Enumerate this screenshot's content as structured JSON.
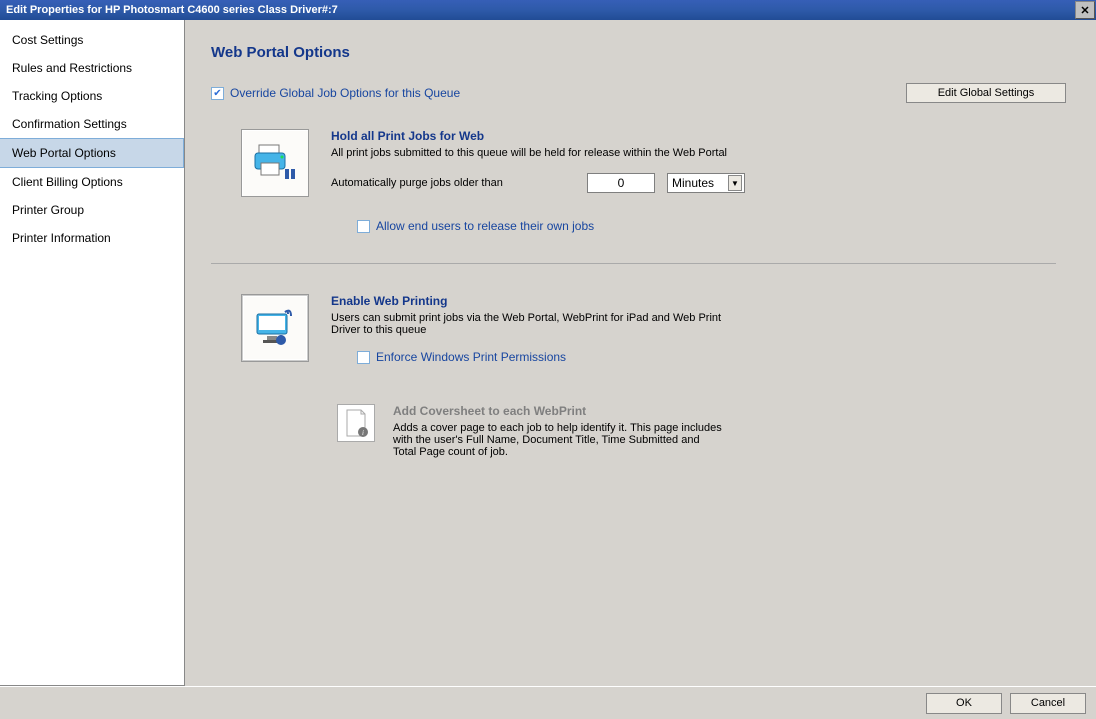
{
  "window": {
    "title": "Edit Properties for HP Photosmart C4600 series Class Driver#:7"
  },
  "sidebar": {
    "items": [
      {
        "label": "Cost Settings"
      },
      {
        "label": "Rules and Restrictions"
      },
      {
        "label": "Tracking Options"
      },
      {
        "label": "Confirmation Settings"
      },
      {
        "label": "Web Portal Options"
      },
      {
        "label": "Client Billing Options"
      },
      {
        "label": "Printer Group"
      },
      {
        "label": "Printer Information"
      }
    ],
    "selected_index": 4
  },
  "page": {
    "title": "Web Portal Options",
    "override_label": "Override Global Job Options for this Queue",
    "override_checked": true,
    "edit_global_label": "Edit Global Settings"
  },
  "hold": {
    "title": "Hold all Print Jobs for Web",
    "desc": "All print jobs submitted to this queue will be held for release within the Web Portal",
    "purge_label": "Automatically purge jobs older than",
    "purge_value": "0",
    "purge_unit": "Minutes",
    "allow_release_label": "Allow end users to release their own jobs",
    "allow_release_checked": false
  },
  "webprint": {
    "title": "Enable Web Printing",
    "desc": "Users can submit print jobs via the Web Portal, WebPrint for iPad and Web Print Driver to this queue",
    "enforce_label": "Enforce Windows Print Permissions",
    "enforce_checked": false
  },
  "coversheet": {
    "title": "Add Coversheet to each WebPrint",
    "desc": "Adds a cover page to each job to help identify it. This page includes with the user's Full Name, Document Title, Time Submitted and Total Page count of job."
  },
  "footer": {
    "ok": "OK",
    "cancel": "Cancel"
  }
}
